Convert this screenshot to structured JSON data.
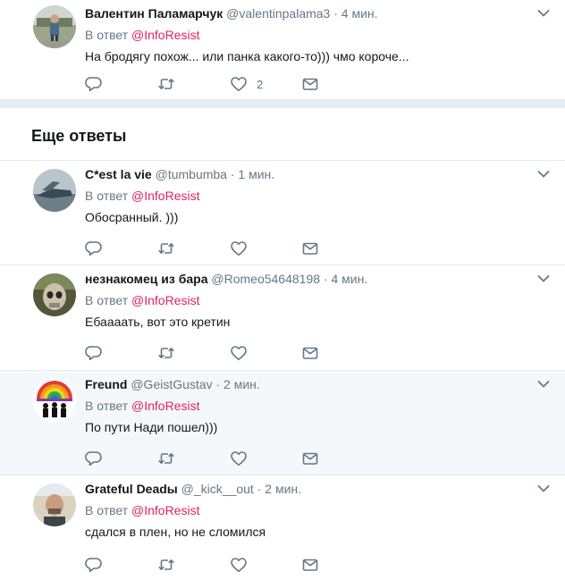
{
  "section_title": "Еще ответы",
  "reply_prefix": "В ответ",
  "tweets": [
    {
      "name": "Валентин Паламарчук",
      "handle": "@valentinpalama3",
      "sep": "·",
      "time": "4 мин.",
      "reply_to": "@InfoResist",
      "text": "На бродягу похож... или панка какого-то))) чмо короче...",
      "likes": "2"
    },
    {
      "name": "C*est la vie",
      "handle": "@tumbumba",
      "sep": "·",
      "time": "1 мин.",
      "reply_to": "@InfoResist",
      "text": "Обосранный. )))",
      "likes": ""
    },
    {
      "name": "незнакомец из бара",
      "handle": "@Romeo54648198",
      "sep": "·",
      "time": "4 мин.",
      "reply_to": "@InfoResist",
      "text": "Ебаааать, вот это кретин",
      "likes": ""
    },
    {
      "name": "Freund",
      "handle": "@GeistGustav",
      "sep": "·",
      "time": "2 мин.",
      "reply_to": "@InfoResist",
      "text": "По пути Нади пошел)))",
      "likes": ""
    },
    {
      "name": "Grateful Deadы",
      "handle": "@_kick__out",
      "sep": "·",
      "time": "2 мин.",
      "reply_to": "@InfoResist",
      "text": "сдался в плен, но не сломился",
      "likes": ""
    }
  ],
  "colors": {
    "accent": "#e0245e",
    "muted": "#657786",
    "text": "#14171a",
    "divider": "#e6ecf0"
  },
  "icons": [
    "reply-icon",
    "retweet-icon",
    "like-icon",
    "dm-icon",
    "chevron-down-icon"
  ]
}
